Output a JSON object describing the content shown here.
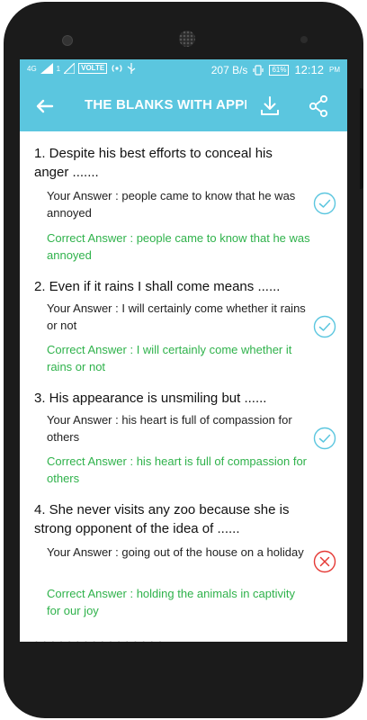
{
  "status_bar": {
    "network": "4G",
    "signal2": "1",
    "volte": "VOLTE",
    "speed": "207 B/s",
    "battery": "61%",
    "time": "12:12",
    "ampm": "PM"
  },
  "toolbar": {
    "title": "THE BLANKS WITH APPRO"
  },
  "questions": [
    {
      "text": "1. Despite his best efforts to conceal his anger .......",
      "your_answer": "Your Answer : people came to know that he was annoyed",
      "correct_answer": "Correct Answer : people came to know that he was annoyed",
      "status": "correct"
    },
    {
      "text": "2. Even if it rains I shall come means ......",
      "your_answer": "Your Answer : I will certainly come whether it rains or not",
      "correct_answer": "Correct Answer : I will certainly come whether it rains or not",
      "status": "correct"
    },
    {
      "text": "3. His appearance is unsmiling but ......",
      "your_answer": "Your Answer : his heart is full of compassion for others",
      "correct_answer": "Correct Answer : his heart is full of compassion for others",
      "status": "correct"
    },
    {
      "text": "4. She never visits any zoo because she is strong opponent of the idea of ......",
      "your_answer": "Your Answer : going out of the house on a holiday",
      "correct_answer": "Correct Answer : holding the animals in captivity for our joy",
      "status": "wrong"
    }
  ],
  "colors": {
    "accent": "#5bc6df",
    "correct_green": "#2fb24b",
    "wrong_red": "#e53935"
  }
}
